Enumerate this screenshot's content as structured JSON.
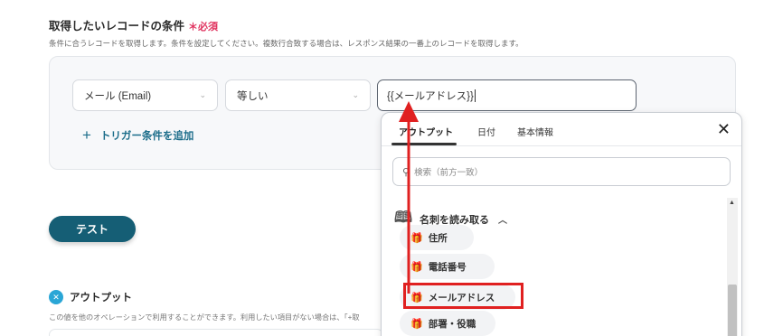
{
  "section": {
    "title": "取得したいレコードの条件",
    "required": "＊必須",
    "description": "条件に合うレコードを取得します。条件を設定してください。複数行合致する場合は、レスポンス結果の一番上のレコードを取得します。"
  },
  "condition": {
    "field_value": "メール (Email)",
    "operator_value": "等しい",
    "input_value": "{{メールアドレス}}",
    "add_label": "トリガー条件を追加"
  },
  "test_button": "テスト",
  "output": {
    "title": "アウトプット",
    "description": "この値を他のオペレーションで利用することができます。利用したい項目がない場合は、「+取"
  },
  "dropdown": {
    "tabs": [
      "アウトプット",
      "日付",
      "基本情報"
    ],
    "active_tab": "アウトプット",
    "search_placeholder": "検索（前方一致）",
    "group_label": "名刺を読み取る",
    "items": [
      "住所",
      "電話番号",
      "メールアドレス",
      "部署・役職"
    ],
    "highlighted_item": "メールアドレス"
  },
  "colors": {
    "primary": "#155e75",
    "link": "#1c6d8a",
    "required": "#e0335f",
    "highlight": "#e02020"
  }
}
